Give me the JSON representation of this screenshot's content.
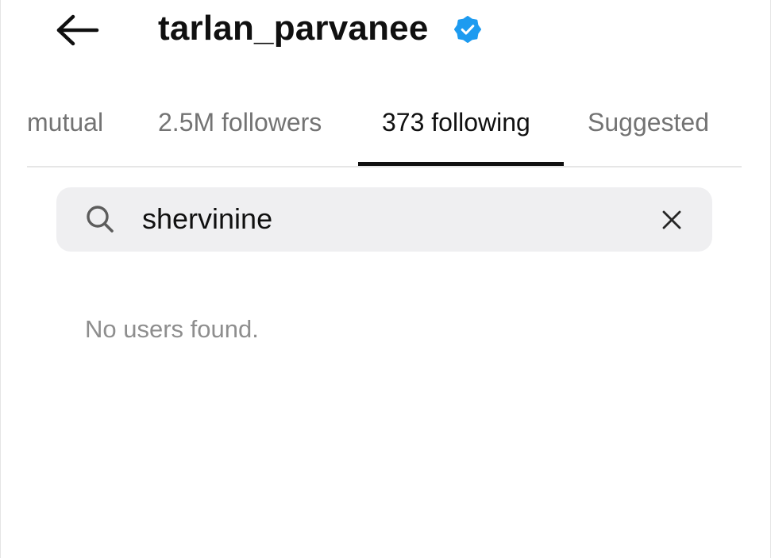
{
  "header": {
    "username": "tarlan_parvanee",
    "verified_color": "#1d9bf0",
    "back_icon": "arrow-left-icon",
    "verified_icon": "verified-badge-icon"
  },
  "tabs": [
    {
      "label": "mutual",
      "active": false
    },
    {
      "label": "2.5M followers",
      "active": false
    },
    {
      "label": "373 following",
      "active": true
    },
    {
      "label": "Suggested",
      "active": false
    }
  ],
  "search": {
    "value": "shervinine",
    "icon": "search-icon",
    "clear_icon": "close-icon"
  },
  "results": {
    "empty_message": "No users found."
  }
}
